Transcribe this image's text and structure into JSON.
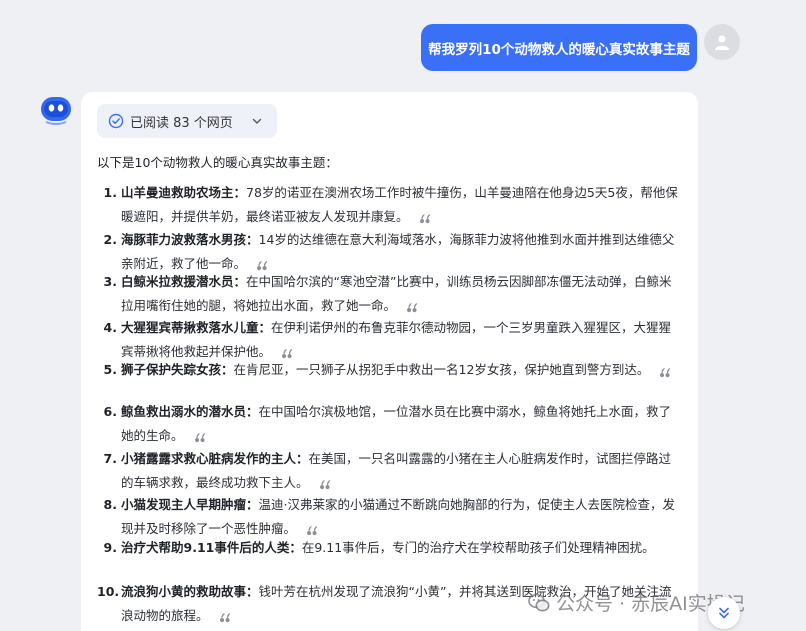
{
  "user_message": "帮我罗列10个动物救人的暖心真实故事主题",
  "read_chip": {
    "label": "已阅读 83 个网页"
  },
  "intro": "以下是10个动物救人的暖心真实故事主题：",
  "items": [
    {
      "num": "1.",
      "title": "山羊曼迪救助农场主：",
      "text": "78岁的诺亚在澳洲农场工作时被牛撞伤，山羊曼迪陪在他身边5天5夜，帮他保暖遮阳，并提供羊奶，最终诺亚被友人发现并康复。"
    },
    {
      "num": "2.",
      "title": "海豚菲力波救落水男孩：",
      "text": "14岁的达维德在意大利海域落水，海豚菲力波将他推到水面并推到达维德父亲附近，救了他一命。"
    },
    {
      "num": "3.",
      "title": "白鲸米拉救援潜水员：",
      "text": "在中国哈尔滨的“寒池空潜”比赛中，训练员杨云因脚部冻僵无法动弹，白鲸米拉用嘴衔住她的腿，将她拉出水面，救了她一命。"
    },
    {
      "num": "4.",
      "title": "大猩猩宾蒂揪救落水儿童：",
      "text": "在伊利诺伊州的布鲁克菲尔德动物园，一个三岁男童跌入猩猩区，大猩猩宾蒂揪将他救起并保护他。"
    },
    {
      "num": "5.",
      "title": "狮子保护失踪女孩：",
      "text": "在肯尼亚，一只狮子从拐犯手中救出一名12岁女孩，保护她直到警方到达。"
    },
    {
      "num": "6.",
      "title": "鲸鱼救出溺水的潜水员：",
      "text": "在中国哈尔滨极地馆，一位潜水员在比赛中溺水，鲸鱼将她托上水面，救了她的生命。"
    },
    {
      "num": "7.",
      "title": "小猪露露求救心脏病发作的主人：",
      "text": "在美国，一只名叫露露的小猪在主人心脏病发作时，试图拦停路过的车辆求救，最终成功救下主人。"
    },
    {
      "num": "8.",
      "title": "小猫发现主人早期肿瘤：",
      "text": "温迪·汉弗莱家的小猫通过不断跳向她胸部的行为，促使主人去医院检查，发现并及时移除了一个恶性肿瘤。"
    },
    {
      "num": "9.",
      "title": "治疗犬帮助9.11事件后的人类：",
      "text": "在9.11事件后，专门的治疗犬在学校帮助孩子们处理精神困扰。"
    },
    {
      "num": "10.",
      "title": "流浪狗小黄的救助故事：",
      "text": "钱叶芳在杭州发现了流浪狗“小黄”，并将其送到医院救治，开始了她关注流浪动物的旅程。"
    }
  ],
  "watermark": "公众号 · 赤辰AI实操记",
  "colors": {
    "accent": "#3a6ff7",
    "background": "#eef0f4",
    "card": "#ffffff"
  },
  "icons": [
    "user-avatar-icon",
    "bot-avatar-icon",
    "check-circle-icon",
    "chevron-down-icon",
    "quote-icon",
    "wechat-icon",
    "scroll-down-icon"
  ]
}
